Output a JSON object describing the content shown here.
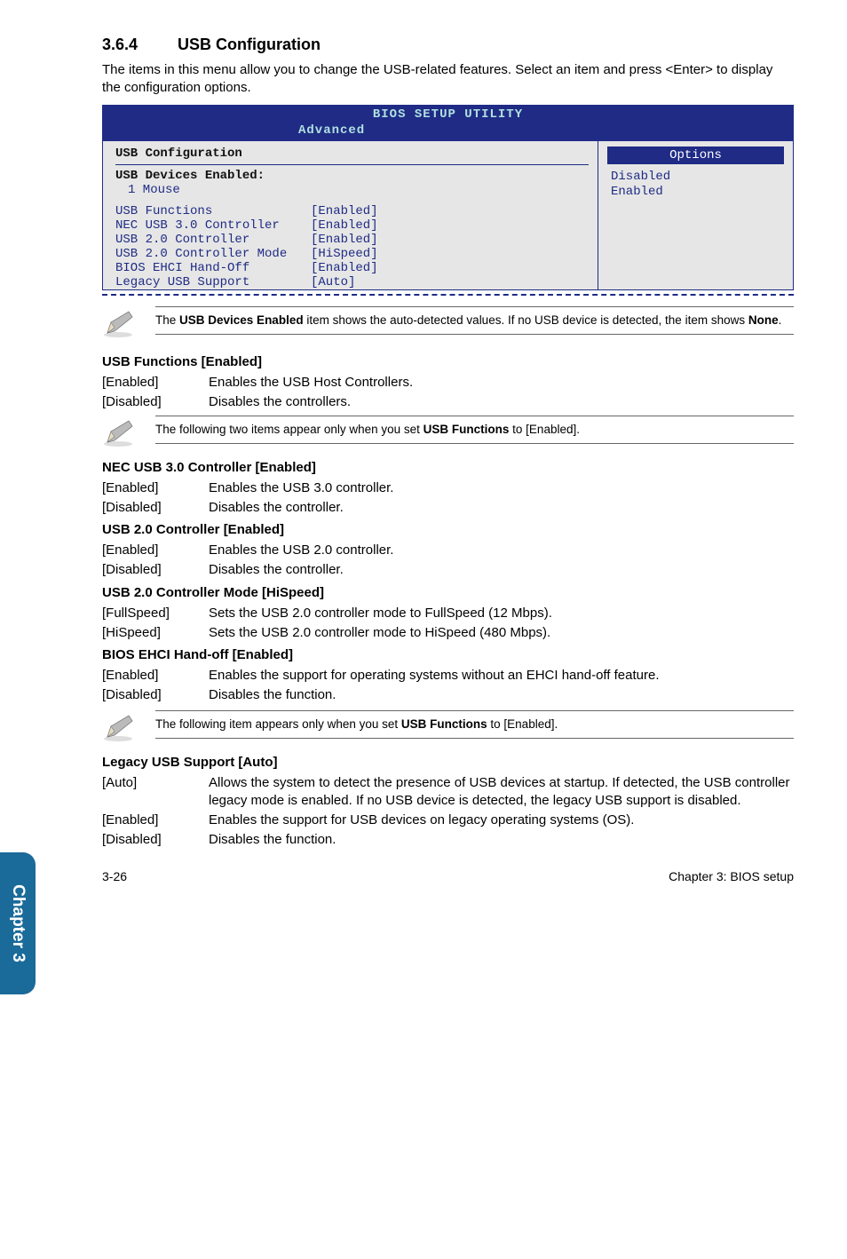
{
  "section": {
    "num": "3.6.4",
    "title": "USB Configuration"
  },
  "intro": "The items in this menu allow you to change the USB-related features. Select an item and press <Enter> to display the configuration options.",
  "bios": {
    "title": "BIOS SETUP UTILITY",
    "tab": "Advanced",
    "left_hdr": "USB Configuration",
    "devices_hdr": "USB Devices Enabled:",
    "devices_line": "1 Mouse",
    "rows": [
      {
        "label": "USB Functions",
        "val": "[Enabled]"
      },
      {
        "label": "NEC USB 3.0 Controller",
        "val": "[Enabled]"
      },
      {
        "label": "USB 2.0 Controller",
        "val": "[Enabled]"
      },
      {
        "label": "USB 2.0 Controller Mode",
        "val": "[HiSpeed]"
      },
      {
        "label": "BIOS EHCI Hand-Off",
        "val": "[Enabled]"
      },
      {
        "label": "Legacy USB Support",
        "val": "[Auto]"
      }
    ],
    "right_hdr": "Options",
    "right_vals": [
      "Disabled",
      "Enabled"
    ]
  },
  "note1_a": "The ",
  "note1_b": "USB Devices Enabled",
  "note1_c": " item shows the auto-detected values. If no USB device is detected, the item shows ",
  "note1_d": "None",
  "note1_e": ".",
  "usb_functions": {
    "title": "USB Functions [Enabled]",
    "en": "Enables the USB Host Controllers.",
    "dis": "Disables the controllers."
  },
  "note2_a": "The following two items appear only when you set ",
  "note2_b": "USB Functions",
  "note2_c": " to [Enabled].",
  "nec": {
    "title": "NEC USB 3.0 Controller [Enabled]",
    "en": "Enables the USB 3.0 controller.",
    "dis": "Disables the controller."
  },
  "usb20": {
    "title": "USB 2.0 Controller [Enabled]",
    "en": "Enables the USB 2.0 controller.",
    "dis": "Disables the controller."
  },
  "usb20mode": {
    "title": "USB 2.0 Controller Mode [HiSpeed]",
    "fs": "Sets the USB 2.0 controller mode to FullSpeed (12 Mbps).",
    "hs": "Sets the USB 2.0 controller mode to HiSpeed (480 Mbps)."
  },
  "ehci": {
    "title": "BIOS EHCI Hand-off [Enabled]",
    "en": "Enables the support for operating systems without an EHCI hand-off feature.",
    "dis": "Disables the function."
  },
  "note3_a": "The following item appears only when you set ",
  "note3_b": "USB Functions",
  "note3_c": " to [Enabled].",
  "labels": {
    "enabled": "[Enabled]",
    "disabled": "[Disabled]",
    "fullspeed": "[FullSpeed]",
    "hispeed": "[HiSpeed]",
    "auto": "[Auto]"
  },
  "legacy": {
    "title": "Legacy USB Support [Auto]",
    "auto": "Allows the system to detect the presence of USB devices at startup. If detected, the USB controller legacy mode is enabled. If no USB device is detected, the legacy USB support is disabled.",
    "en": "Enables the support for USB devices on legacy operating systems (OS).",
    "dis": "Disables the function."
  },
  "chapter_tab": "Chapter 3",
  "footer_left": "3-26",
  "footer_right": "Chapter 3: BIOS setup"
}
